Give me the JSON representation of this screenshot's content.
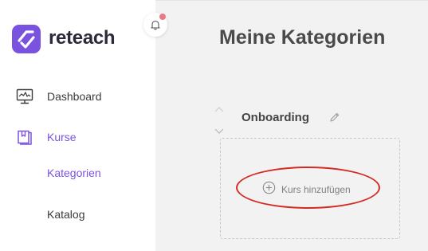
{
  "brand": {
    "name": "reteach",
    "color": "#7a52e0"
  },
  "sidebar": {
    "items": [
      {
        "label": "Dashboard",
        "icon": "dashboard-monitor-icon"
      },
      {
        "label": "Kurse",
        "icon": "book-icon",
        "active": true,
        "color": "#7a52e0"
      }
    ],
    "subitems": [
      {
        "label": "Kategorien",
        "active": true,
        "color": "#7a52e0"
      },
      {
        "label": "Katalog"
      }
    ]
  },
  "header": {
    "notification_icon": "bell-icon",
    "has_unread": true
  },
  "main": {
    "title": "Meine Kategorien",
    "categories": [
      {
        "name": "Onboarding",
        "add_course_label": "Kurs hinzufügen"
      }
    ]
  }
}
